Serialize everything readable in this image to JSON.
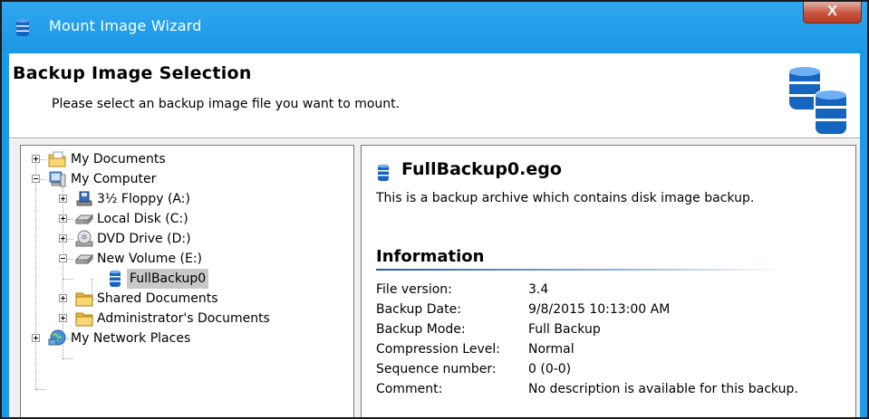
{
  "window": {
    "title": "Mount Image Wizard",
    "close_glyph": "X",
    "icon": "database-icon"
  },
  "header": {
    "title": "Backup Image Selection",
    "subtitle": "Please select an backup image file you want to mount.",
    "art_icon": "database-stack-icon"
  },
  "tree": {
    "items": [
      {
        "label": "My Documents",
        "icon": "documents-folder-icon",
        "expander": "plus",
        "level": 0
      },
      {
        "label": "My Computer",
        "icon": "computer-icon",
        "expander": "minus",
        "level": 0
      },
      {
        "label": "3½ Floppy (A:)",
        "icon": "floppy-drive-icon",
        "expander": "plus",
        "level": 1
      },
      {
        "label": "Local Disk (C:)",
        "icon": "hard-disk-icon",
        "expander": "plus",
        "level": 1
      },
      {
        "label": "DVD Drive (D:)",
        "icon": "dvd-drive-icon",
        "expander": "plus",
        "level": 1
      },
      {
        "label": "New Volume (E:)",
        "icon": "hard-disk-icon",
        "expander": "minus",
        "level": 1
      },
      {
        "label": "FullBackup0",
        "icon": "database-icon",
        "expander": "none",
        "level": 2,
        "selected": true
      },
      {
        "label": "Shared Documents",
        "icon": "folder-icon",
        "expander": "plus",
        "level": 1
      },
      {
        "label": "Administrator's Documents",
        "icon": "folder-icon",
        "expander": "plus",
        "level": 1
      },
      {
        "label": "My Network Places",
        "icon": "network-icon",
        "expander": "plus",
        "level": 0
      }
    ]
  },
  "detail": {
    "file_name": "FullBackup0.ego",
    "file_icon": "database-icon",
    "description": "This is a backup archive which contains disk image backup.",
    "info_title": "Information",
    "rows": [
      {
        "key": "File version:",
        "value": "3.4"
      },
      {
        "key": "Backup Date:",
        "value": "9/8/2015 10:13:00 AM"
      },
      {
        "key": "Backup Mode:",
        "value": "Full Backup"
      },
      {
        "key": "Compression Level:",
        "value": "Normal"
      },
      {
        "key": "Sequence number:",
        "value": "0 (0-0)"
      },
      {
        "key": "Comment:",
        "value": "No description is available for this backup."
      }
    ]
  },
  "colors": {
    "titlebar": "#1d9be8",
    "selection": "#c8c8c8",
    "database_blue": "#1565c0",
    "rule": "#1f5aa6"
  }
}
